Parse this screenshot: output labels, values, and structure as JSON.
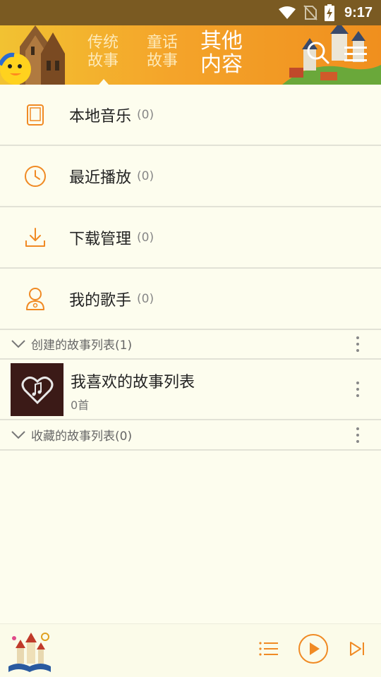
{
  "status_bar": {
    "time": "9:17"
  },
  "header": {
    "tabs": [
      {
        "line1": "传统",
        "line2": "故事",
        "active": false
      },
      {
        "line1": "童话",
        "line2": "故事",
        "active": false
      },
      {
        "line1": "其他",
        "line2": "内容",
        "active": true
      }
    ],
    "icons": [
      "search-icon",
      "menu-icon"
    ]
  },
  "menu": [
    {
      "label": "本地音乐",
      "count": "(0)",
      "icon": "tablet-icon"
    },
    {
      "label": "最近播放",
      "count": "(0)",
      "icon": "clock-icon"
    },
    {
      "label": "下载管理",
      "count": "(0)",
      "icon": "download-icon"
    },
    {
      "label": "我的歌手",
      "count": "(0)",
      "icon": "singer-icon"
    }
  ],
  "sections": {
    "created": {
      "label": "创建的故事列表(1)"
    },
    "collected": {
      "label": "收藏的故事列表(0)"
    }
  },
  "playlists": [
    {
      "title": "我喜欢的故事列表",
      "subtitle": "0首",
      "cover_icon": "heart-music-icon"
    }
  ],
  "player": {
    "icons": [
      "playlist-icon",
      "play-icon",
      "next-icon"
    ]
  },
  "colors": {
    "accent": "#f08a24",
    "background": "#fdfdee",
    "status_bar": "#7a5a22",
    "divider": "#e2e2d6"
  }
}
